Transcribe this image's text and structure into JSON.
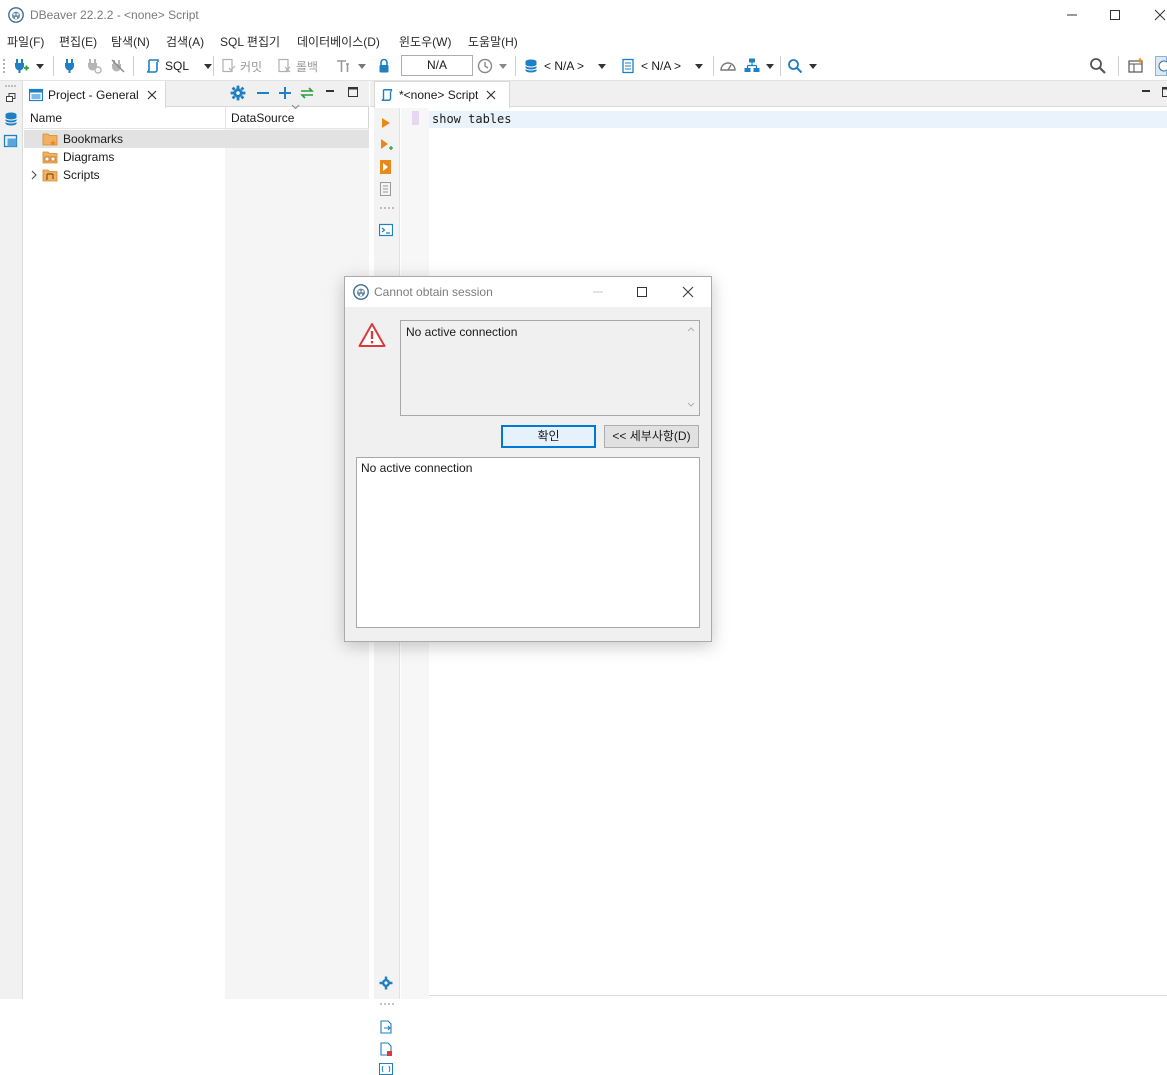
{
  "window": {
    "title": "DBeaver 22.2.2 - <none> Script"
  },
  "menu": [
    "파일(F)",
    "편집(E)",
    "탐색(N)",
    "검색(A)",
    "SQL 편집기",
    "데이터베이스(D)",
    "윈도우(W)",
    "도움말(H)"
  ],
  "toolbar": {
    "sql_label": "SQL",
    "commit_label": "커밋",
    "rollback_label": "롤백",
    "transaction_field": "N/A",
    "datasource_selector": "< N/A >",
    "schema_selector": "< N/A >"
  },
  "project_panel": {
    "tab_label": "Project - General",
    "columns": {
      "name": "Name",
      "datasource": "DataSource"
    },
    "items": [
      {
        "label": "Bookmarks",
        "icon": "bookmarks-folder-icon"
      },
      {
        "label": "Diagrams",
        "icon": "diagrams-folder-icon"
      },
      {
        "label": "Scripts",
        "icon": "scripts-folder-icon"
      }
    ]
  },
  "editor": {
    "tab_label": "*<none> Script",
    "code": "show tables"
  },
  "dialog": {
    "title": "Cannot obtain session",
    "message": "No active connection",
    "ok_label": "확인",
    "details_label": "<< 세부사항(D)",
    "details_text": "No active connection"
  },
  "colors": {
    "accent": "#1e7fc2",
    "orange": "#e8891c",
    "warning_red": "#d93a3a",
    "ok_border": "#0078d7"
  }
}
